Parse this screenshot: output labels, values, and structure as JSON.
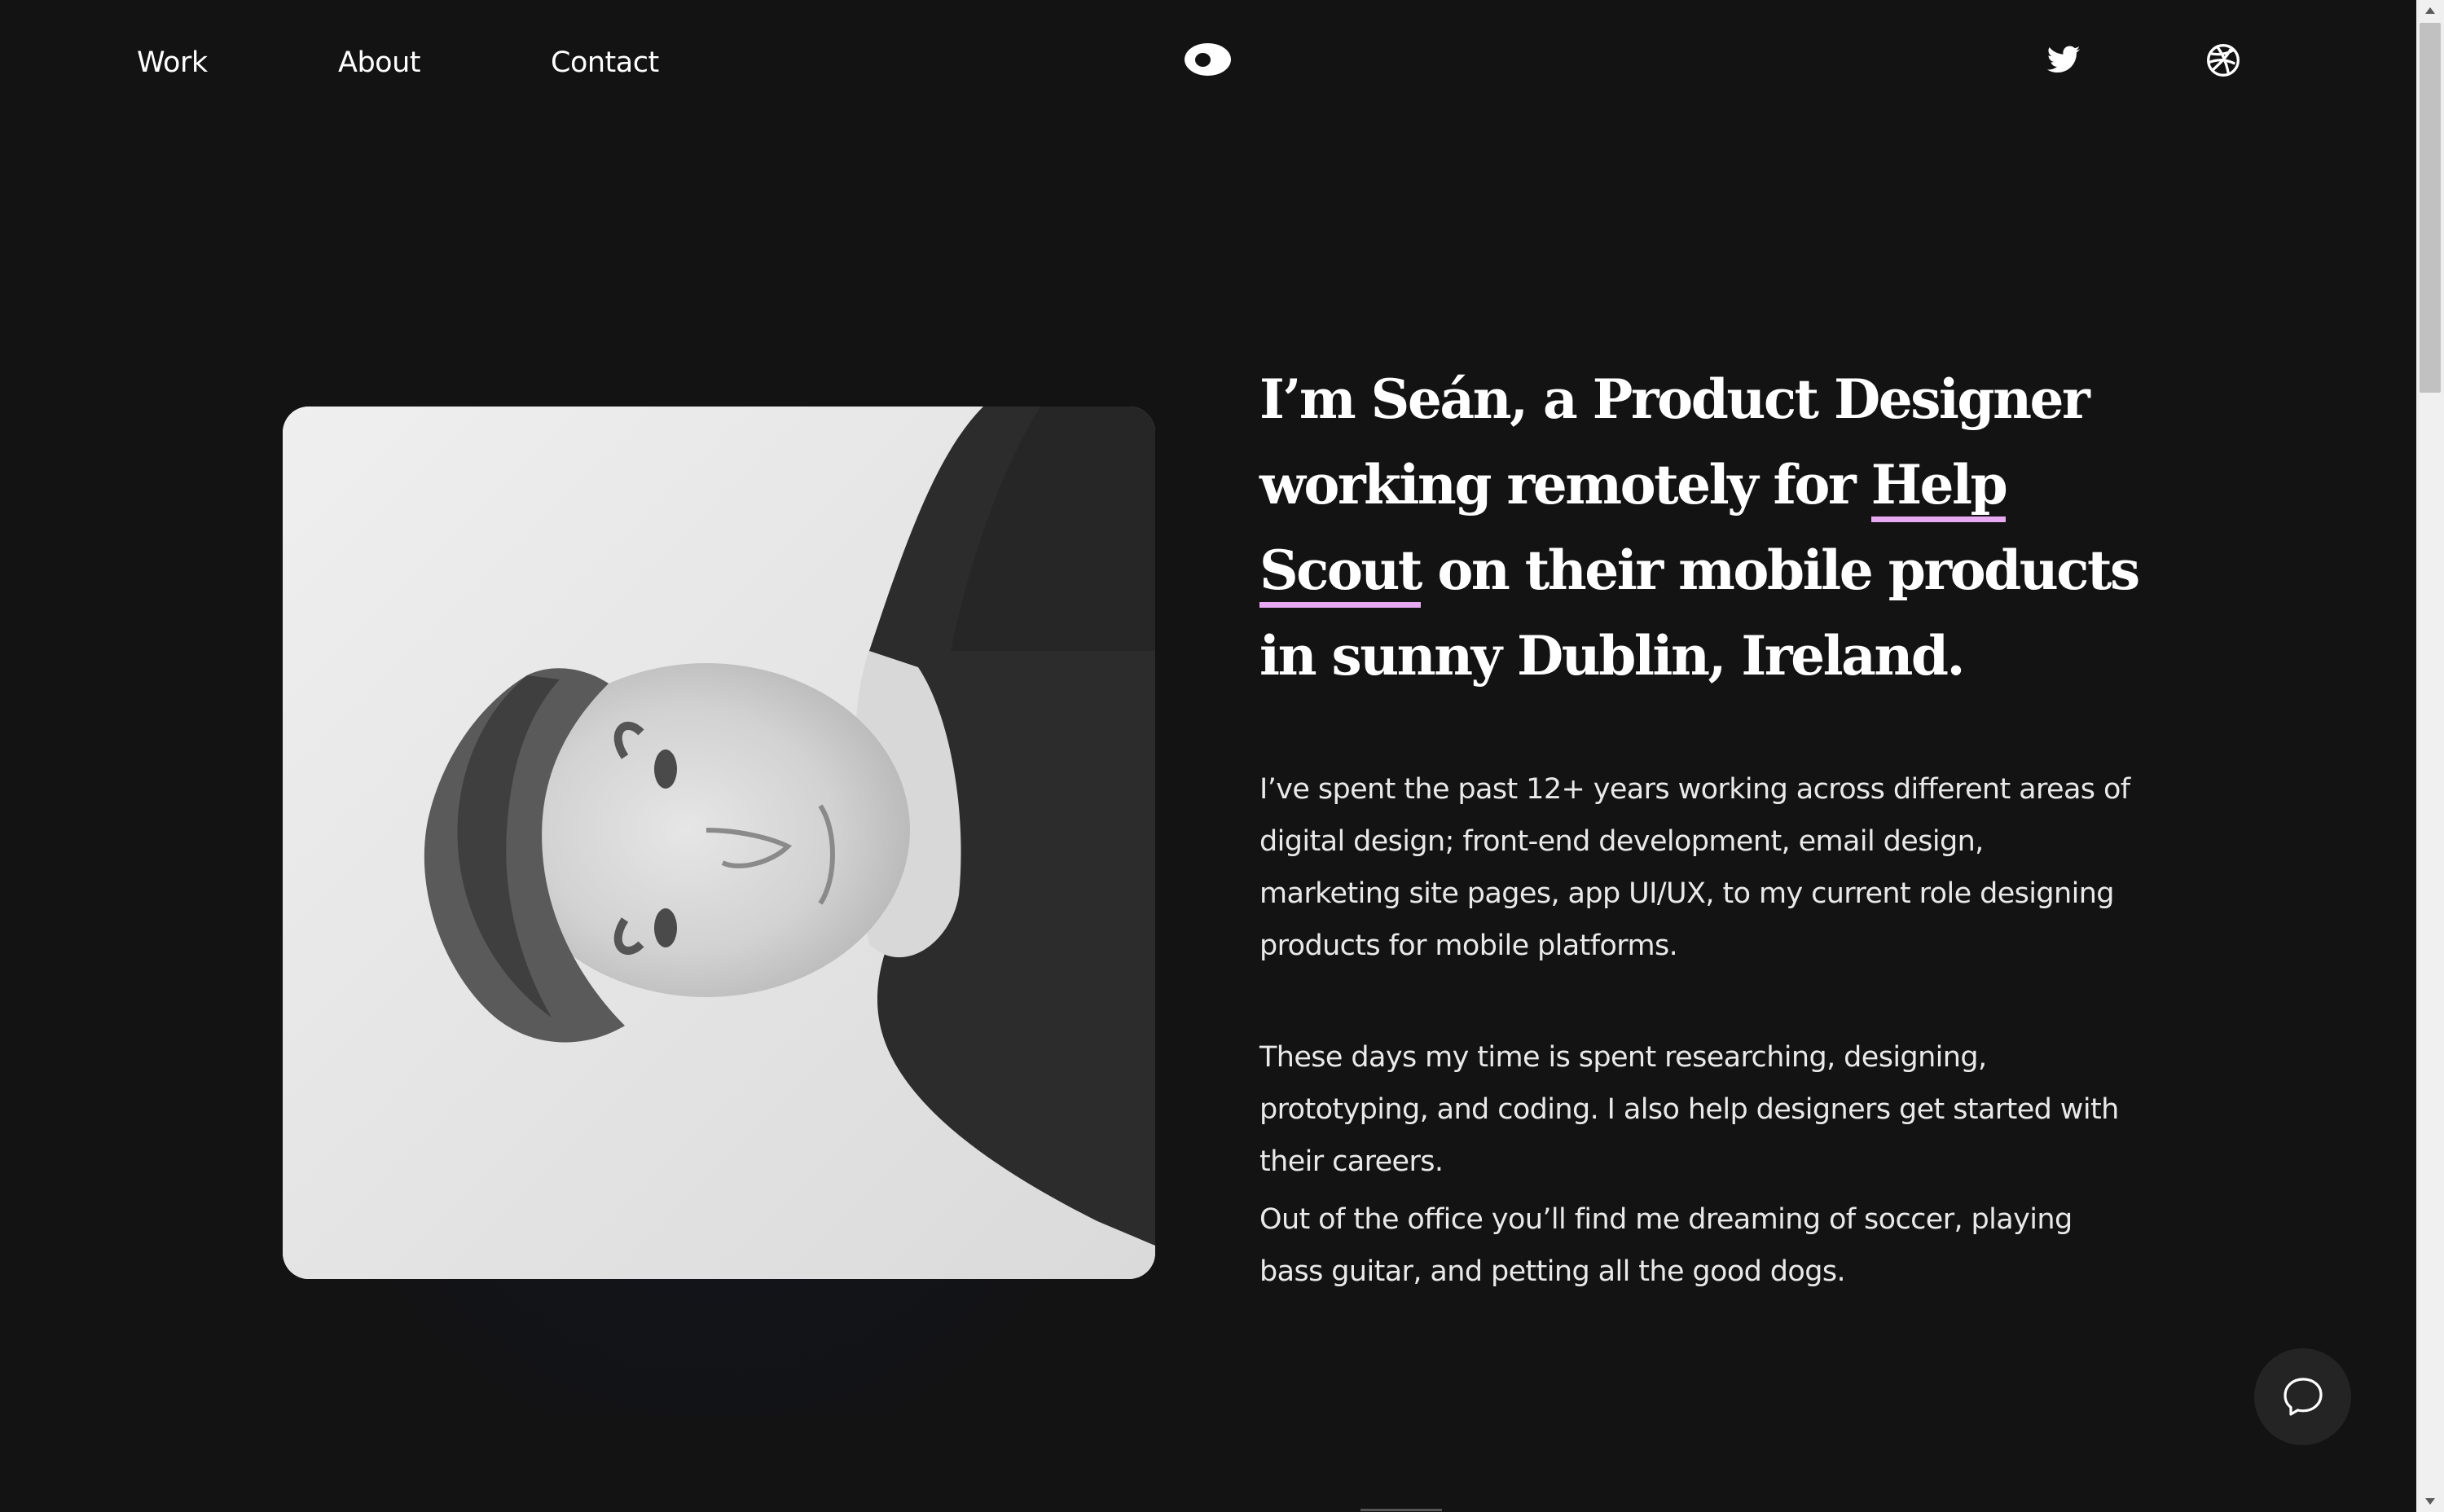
{
  "nav": {
    "items": [
      {
        "label": "Work"
      },
      {
        "label": "About"
      },
      {
        "label": "Contact"
      }
    ],
    "logo_icon": "eye-icon",
    "social": [
      {
        "icon": "twitter-icon"
      },
      {
        "icon": "dribbble-icon"
      }
    ]
  },
  "hero": {
    "headline_before": "I’m Seán, a Product Designer working remotely for ",
    "headline_link": "Help Scout",
    "headline_after": " on their mobile products in sunny Dublin, Ireland.",
    "link_underline_color": "#e6a9f2",
    "paragraphs": [
      "I’ve spent the past 12+ years working across different areas of digital design; front-end development, email design, marketing site pages, app UI/UX, to my current role designing products for mobile platforms.",
      "These days my time is spent researching, designing, prototyping, and coding. I also help designers get started with their careers.",
      "Out of the office you’ll find me dreaming of soccer, playing bass guitar, and petting all the good dogs."
    ]
  },
  "chat": {
    "icon": "chat-bubble-icon"
  },
  "colors": {
    "background": "#131313",
    "text": "#ffffff",
    "chat_button": "#242424"
  }
}
